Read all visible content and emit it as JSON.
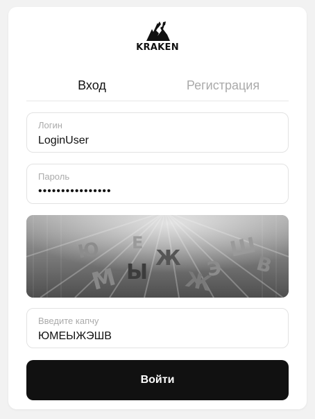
{
  "brand": {
    "logo_text": "KRAKEN"
  },
  "tabs": [
    {
      "label": "Вход",
      "active": true
    },
    {
      "label": "Регистрация",
      "active": false
    }
  ],
  "form": {
    "login": {
      "label": "Логин",
      "value": "LoginUser"
    },
    "password": {
      "label": "Пароль",
      "value_masked": "••••••••••••••••"
    },
    "captcha": {
      "image_text": "ЮМЕЫЖЭШВ",
      "label": "Введите капчу",
      "value": "ЮМЕЫЖЭШВ"
    },
    "submit_label": "Войти"
  },
  "colors": {
    "accent": "#111111",
    "muted_text": "#aaaaaa",
    "border": "#e2e2e2",
    "page_bg": "#f2f2f2"
  }
}
